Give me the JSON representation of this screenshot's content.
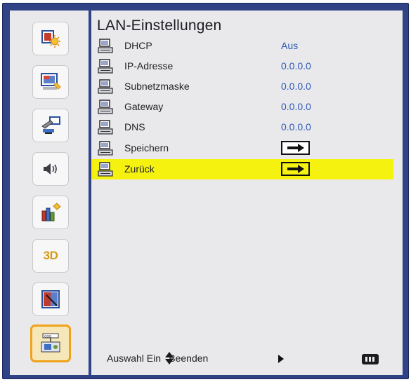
{
  "title": "LAN-Einstellungen",
  "sidebar": {
    "items": [
      {
        "icon": "image-settings-icon"
      },
      {
        "icon": "display-settings-icon"
      },
      {
        "icon": "setup-settings-icon"
      },
      {
        "icon": "audio-icon",
        "glyph": "◁))"
      },
      {
        "icon": "options-icon"
      },
      {
        "icon": "3d-icon",
        "text": "3D"
      },
      {
        "icon": "interactive-icon"
      },
      {
        "icon": "lan-icon",
        "active": true
      }
    ]
  },
  "rows": [
    {
      "label": "DHCP",
      "value": "Aus"
    },
    {
      "label": "IP-Adresse",
      "value": "0.0.0.0"
    },
    {
      "label": "Subnetzmaske",
      "value": "0.0.0.0"
    },
    {
      "label": "Gateway",
      "value": "0.0.0.0"
    },
    {
      "label": "DNS",
      "value": "0.0.0.0"
    },
    {
      "label": "Speichern",
      "action": "enter"
    },
    {
      "label": "Zurück",
      "action": "enter",
      "selected": true
    }
  ],
  "footer": {
    "hint": "Auswahl Ein    Beenden"
  },
  "colors": {
    "frame": "#2f4386",
    "panel": "#e9e9eb",
    "highlight": "#f6f20f",
    "value_text": "#2d58b8",
    "active_tile_border": "#f0a21a"
  }
}
